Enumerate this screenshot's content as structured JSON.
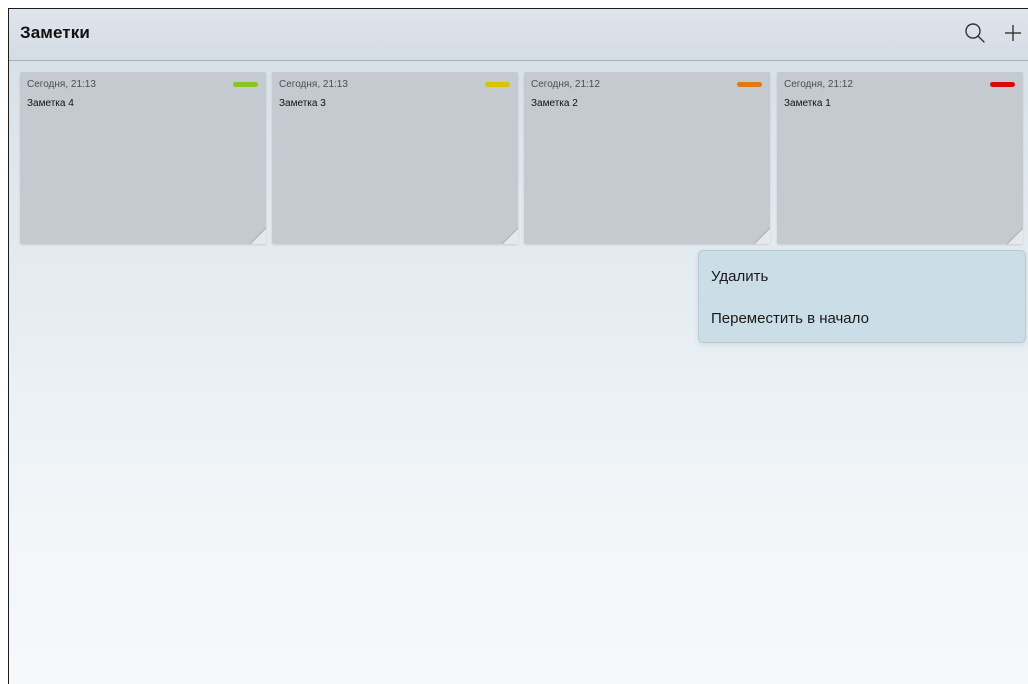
{
  "app": {
    "title": "Заметки"
  },
  "header": {
    "search_icon": "search-icon",
    "add_icon": "plus-icon"
  },
  "notes": [
    {
      "date": "Сегодня, 21:13",
      "title": "Заметка 4",
      "color": "#86c81e"
    },
    {
      "date": "Сегодня, 21:13",
      "title": "Заметка 3",
      "color": "#d9c400"
    },
    {
      "date": "Сегодня, 21:12",
      "title": "Заметка 2",
      "color": "#e07b12"
    },
    {
      "date": "Сегодня, 21:12",
      "title": "Заметка 1",
      "color": "#d90a0a"
    }
  ],
  "context_menu": {
    "delete_label": "Удалить",
    "move_label": "Переместить в начало"
  }
}
